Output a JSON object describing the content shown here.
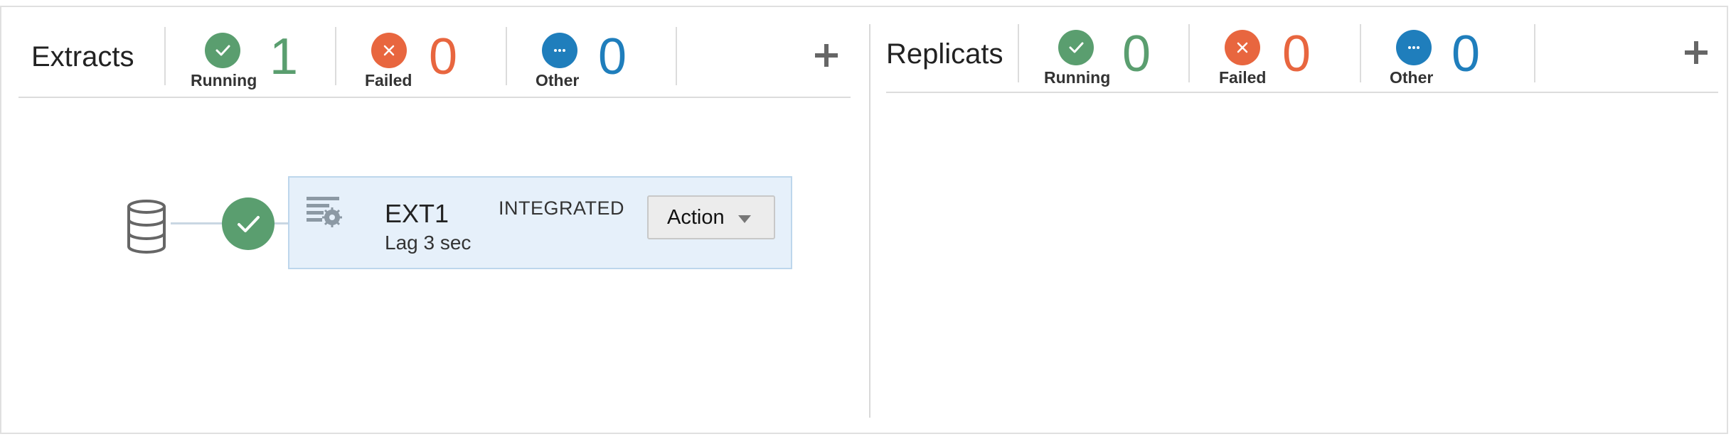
{
  "extracts": {
    "title": "Extracts",
    "stats": {
      "running": {
        "label": "Running",
        "count": "1"
      },
      "failed": {
        "label": "Failed",
        "count": "0"
      },
      "other": {
        "label": "Other",
        "count": "0"
      }
    },
    "items": [
      {
        "name": "EXT1",
        "type": "INTEGRATED",
        "lag": "Lag 3 sec",
        "action_label": "Action",
        "status": "running"
      }
    ]
  },
  "replicats": {
    "title": "Replicats",
    "stats": {
      "running": {
        "label": "Running",
        "count": "0"
      },
      "failed": {
        "label": "Failed",
        "count": "0"
      },
      "other": {
        "label": "Other",
        "count": "0"
      }
    },
    "items": []
  },
  "colors": {
    "running": "#5a9e6f",
    "failed": "#e8663f",
    "other": "#1f7ebc",
    "card_bg": "#e6f0fa"
  },
  "icons": {
    "running": "check-icon",
    "failed": "x-icon",
    "other": "ellipsis-icon",
    "add": "plus-icon",
    "database": "database-icon",
    "extract": "extract-settings-icon",
    "dropdown": "caret-down-icon"
  }
}
